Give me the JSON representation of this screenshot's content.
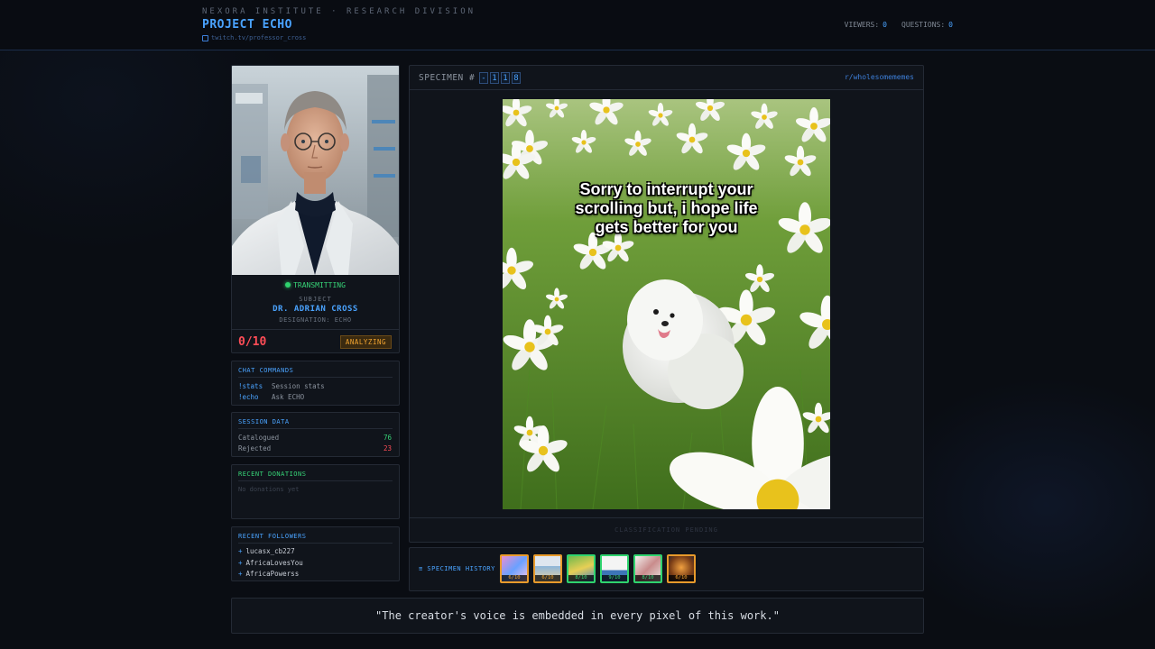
{
  "header": {
    "org": "NEXORA INSTITUTE · RESEARCH DIVISION",
    "project": "PROJECT ECHO",
    "channel": "twitch.tv/professor_cross",
    "viewers_label": "VIEWERS:",
    "viewers_value": "0",
    "questions_label": "QUESTIONS:",
    "questions_value": "0"
  },
  "profile": {
    "status": "TRANSMITTING",
    "subject_label": "SUBJECT",
    "name": "DR. ADRIAN CROSS",
    "designation": "DESIGNATION: ECHO",
    "score": "0/10",
    "state": "ANALYZING"
  },
  "commands": {
    "title": "CHAT COMMANDS",
    "items": [
      {
        "key": "!stats",
        "desc": "Session stats"
      },
      {
        "key": "!echo",
        "desc": "Ask ECHO"
      }
    ]
  },
  "session": {
    "title": "SESSION DATA",
    "catalogued_label": "Catalogued",
    "catalogued_value": "76",
    "rejected_label": "Rejected",
    "rejected_value": "23",
    "colors": {
      "catalogued": "#37d477",
      "rejected": "#ff4d57"
    }
  },
  "donations": {
    "title": "RECENT DONATIONS",
    "empty": "No donations yet"
  },
  "followers": {
    "title": "RECENT FOLLOWERS",
    "items": [
      "lucasx_cb227",
      "AfricaLovesYou",
      "AfricaPowerss"
    ]
  },
  "specimen": {
    "label": "SPECIMEN #",
    "digits": [
      "-",
      "1",
      "1",
      "8"
    ],
    "subreddit": "r/wholesomememes",
    "meme_text": "Sorry to interrupt your scrolling but, i hope life gets better for you",
    "footer": "CLASSIFICATION PENDING"
  },
  "history": {
    "label": "≡ SPECIMEN HISTORY",
    "items": [
      {
        "score": "6/10",
        "color": "orange"
      },
      {
        "score": "6/10",
        "color": "orange"
      },
      {
        "score": "8/10",
        "color": "green"
      },
      {
        "score": "9/10",
        "color": "green"
      },
      {
        "score": "8/10",
        "color": "green"
      },
      {
        "score": "6/10",
        "color": "orange"
      }
    ]
  },
  "quote": "\"The creator's voice is embedded in every pixel of this work.\""
}
